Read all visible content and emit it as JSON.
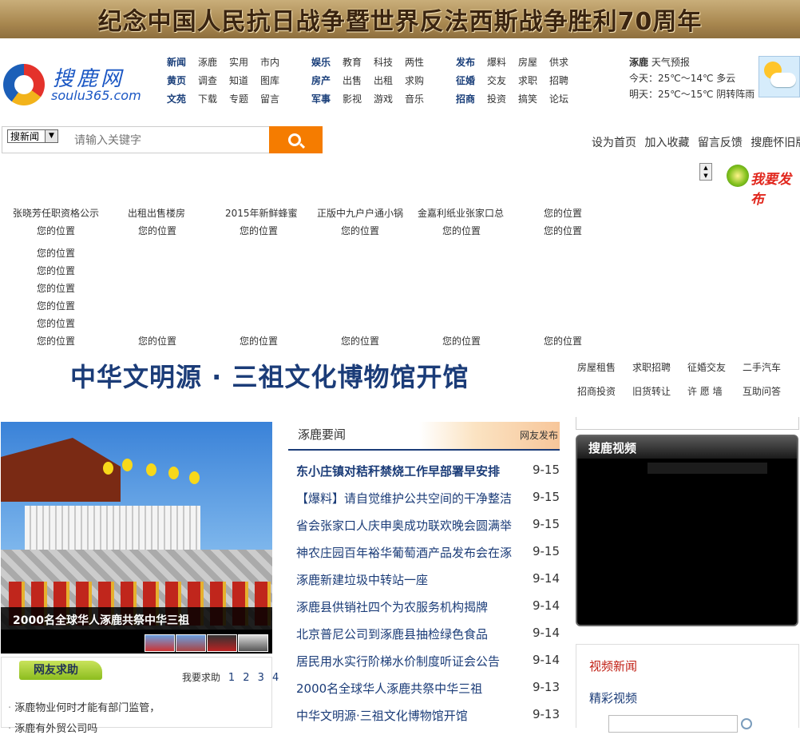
{
  "banner": {
    "text": "纪念中国人民抗日战争暨世界反法西斯战争胜利70周年"
  },
  "logo": {
    "cn": "搜鹿网",
    "en": "soulu365.com"
  },
  "nav": {
    "rows": [
      [
        "新闻",
        "涿鹿",
        "实用",
        "市内",
        "娱乐",
        "教育",
        "科技",
        "两性",
        "发布",
        "爆料",
        "房屋",
        "供求"
      ],
      [
        "黄页",
        "调查",
        "知道",
        "图库",
        "房产",
        "出售",
        "出租",
        "求购",
        "征婚",
        "交友",
        "求职",
        "招聘"
      ],
      [
        "文苑",
        "下载",
        "专题",
        "留言",
        "军事",
        "影视",
        "游戏",
        "音乐",
        "招商",
        "投资",
        "搞笑",
        "论坛"
      ]
    ]
  },
  "weather": {
    "city": "涿鹿",
    "label": "天气预报",
    "today": "今天：25℃～14℃ 多云",
    "tomorrow": "明天：25℃～15℃ 阴转阵雨",
    "icon": "partly-cloudy-icon"
  },
  "search": {
    "scope": "搜新闻",
    "placeholder": "请输入关键字"
  },
  "toplinks": [
    "设为首页",
    "加入收藏",
    "留言反馈",
    "搜鹿怀旧版"
  ],
  "post_button": "我要发布",
  "ad_row1": [
    "张晓芳任职资格公示",
    "出租出售楼房",
    "2015年新鲜蜂蜜",
    "正版中九户户通小锅",
    "金嘉利纸业张家口总",
    "您的位置"
  ],
  "ad_placeholder": "您的位置",
  "headline": "中华文明源 · 三祖文化博物馆开馆",
  "quick_links": [
    [
      "房屋租售",
      "求职招聘",
      "征婚交友",
      "二手汽车"
    ],
    [
      "招商投资",
      "旧货转让",
      "许 愿 墙",
      "互助问答"
    ]
  ],
  "slideshow": {
    "caption": "2000名全球华人涿鹿共祭中华三祖"
  },
  "help": {
    "tab": "网友求助",
    "more": "我要求助",
    "pages": "1 2 3 4",
    "items": [
      "涿鹿物业何时才能有部门监管，",
      "涿鹿有外贸公司吗"
    ]
  },
  "news": {
    "title": "涿鹿要闻",
    "badge": "网友发布",
    "items": [
      {
        "title": "东小庄镇对秸秆禁烧工作早部署早安排",
        "date": "9-15"
      },
      {
        "title": "【爆料】请自觉维护公共空间的干净整洁",
        "date": "9-15"
      },
      {
        "title": "省会张家口人庆申奥成功联欢晚会圆满举",
        "date": "9-15"
      },
      {
        "title": "神农庄园百年裕华葡萄酒产品发布会在涿",
        "date": "9-15"
      },
      {
        "title": "涿鹿新建垃圾中转站一座",
        "date": "9-14"
      },
      {
        "title": "涿鹿县供销社四个为农服务机构揭牌",
        "date": "9-14"
      },
      {
        "title": "北京普尼公司到涿鹿县抽检绿色食品",
        "date": "9-14"
      },
      {
        "title": "居民用水实行阶梯水价制度听证会公告",
        "date": "9-14"
      },
      {
        "title": "2000名全球华人涿鹿共祭中华三祖",
        "date": "9-13"
      },
      {
        "title": "中华文明源·三祖文化博物馆开馆",
        "date": "9-13"
      }
    ]
  },
  "video": {
    "title": "搜鹿视频",
    "link1": "视频新闻",
    "link2": "精彩视频"
  }
}
